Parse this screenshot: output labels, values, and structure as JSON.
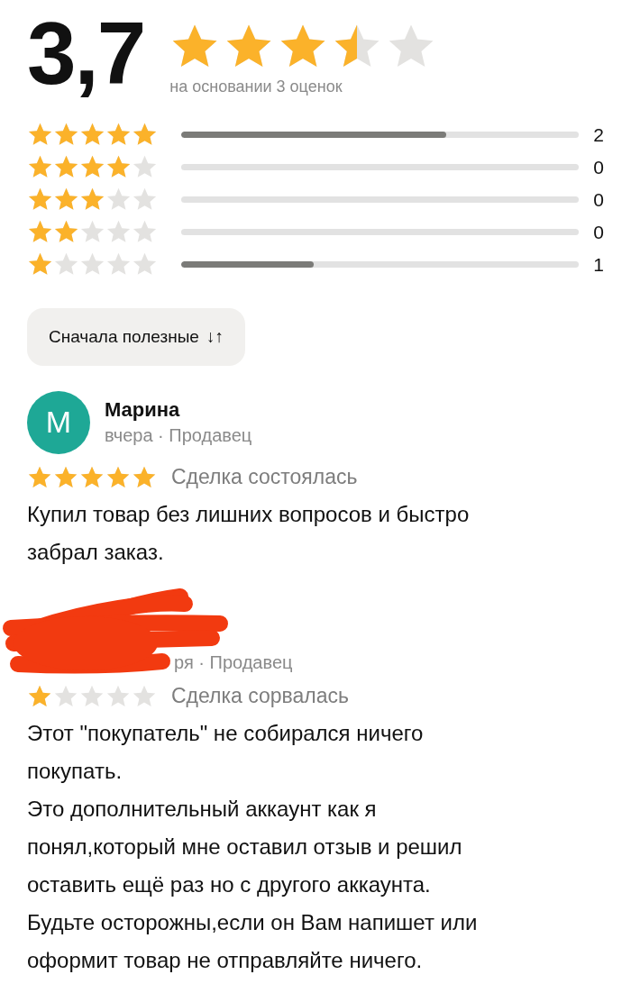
{
  "summary": {
    "score": "3,7",
    "stars": 3.5,
    "caption": "на основании 3 оценок"
  },
  "distribution": [
    {
      "stars": 5,
      "level": 0.667,
      "count": "2"
    },
    {
      "stars": 4,
      "level": 0,
      "count": "0"
    },
    {
      "stars": 3,
      "level": 0,
      "count": "0"
    },
    {
      "stars": 2,
      "level": 0,
      "count": "0"
    },
    {
      "stars": 1,
      "level": 0.333,
      "count": "1"
    }
  ],
  "sort_button": {
    "label": "Сначала полезные",
    "icon": "↓↑"
  },
  "reviews": [
    {
      "covered": false,
      "avatar": "М",
      "name": "Марина",
      "meta": "вчера · Продавец",
      "stars": 5,
      "status": "Сделка состоялась",
      "text": [
        "Купил товар без лишних вопросов и быстро забрал заказ."
      ]
    },
    {
      "covered": true,
      "meta": "ря · Продавец",
      "stars": 1,
      "status": "Сделка сорвалась",
      "text": [
        "Этот \"покупатель\" не собирался ничего покупать.",
        "Это дополнительный аккаунт как я понял,который мне оставил отзыв и решил оставить ещё раз но с другого аккаунта.",
        "Будьте осторожны,если он Вам напишет или оформит товар не отправляйте ничего."
      ]
    }
  ]
}
